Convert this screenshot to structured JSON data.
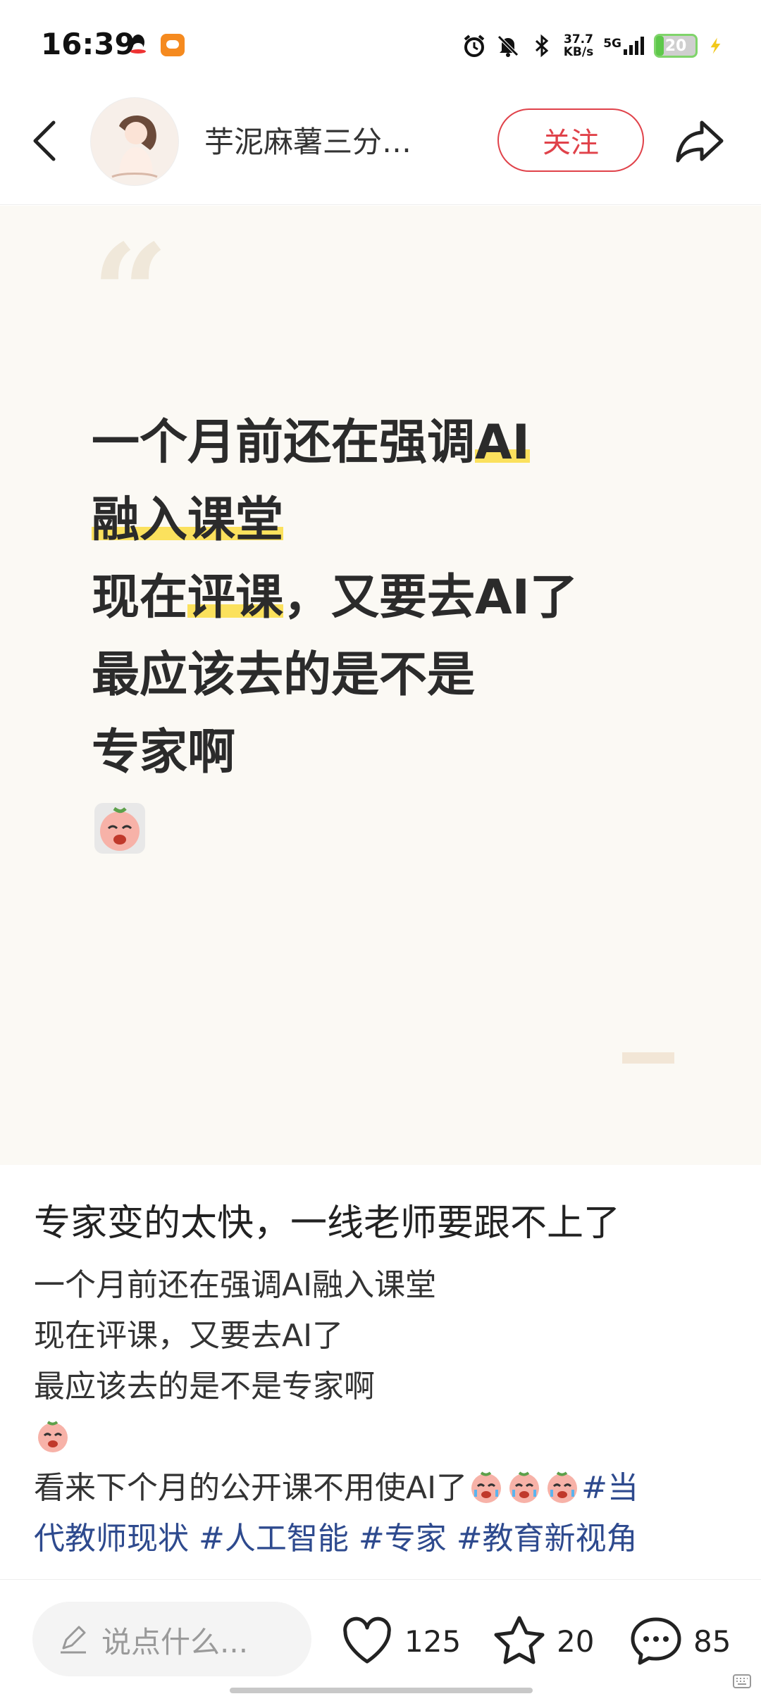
{
  "status_bar": {
    "time": "16:39",
    "net_speed_value": "37.7",
    "net_speed_unit": "KB/s",
    "network_type": "5G",
    "battery": "20",
    "icons": [
      "qq-icon",
      "message-icon",
      "alarm-icon",
      "mute-icon",
      "bluetooth-icon",
      "signal-icon",
      "battery-icon",
      "charging-icon"
    ]
  },
  "header": {
    "author_name": "芋泥麻薯三分…",
    "follow_label": "关注"
  },
  "card": {
    "lines": [
      {
        "segments": [
          {
            "text": "一个月前还在强调"
          },
          {
            "text": "AI",
            "highlight": true
          }
        ]
      },
      {
        "segments": [
          {
            "text": "融入课堂",
            "highlight": true
          }
        ]
      },
      {
        "segments": [
          {
            "text": "现在"
          },
          {
            "text": "评课",
            "highlight": true
          },
          {
            "text": "，又要去AI了"
          }
        ]
      },
      {
        "segments": [
          {
            "text": "最应该去的是不是"
          }
        ]
      },
      {
        "segments": [
          {
            "text": "专家啊"
          }
        ]
      }
    ],
    "highlight_color": "#fbe15d"
  },
  "post": {
    "title": "专家变的太快，一线老师要跟不上了",
    "line1": "一个月前还在强调AI融入课堂",
    "line2": "现在评课，又要去AI了",
    "line3": "最应该去的是不是专家啊",
    "line5": "看来下个月的公开课不用使AI了",
    "tag1": "#当",
    "line6_tags": "代教师现状 #人工智能 #专家 #教育新视角",
    "tag_color": "#2e4a8e"
  },
  "bottom_bar": {
    "comment_placeholder": "说点什么...",
    "likes": "125",
    "favorites": "20",
    "comments": "85"
  },
  "colors": {
    "accent_red": "#e0424a",
    "card_bg": "#fbf9f4"
  }
}
